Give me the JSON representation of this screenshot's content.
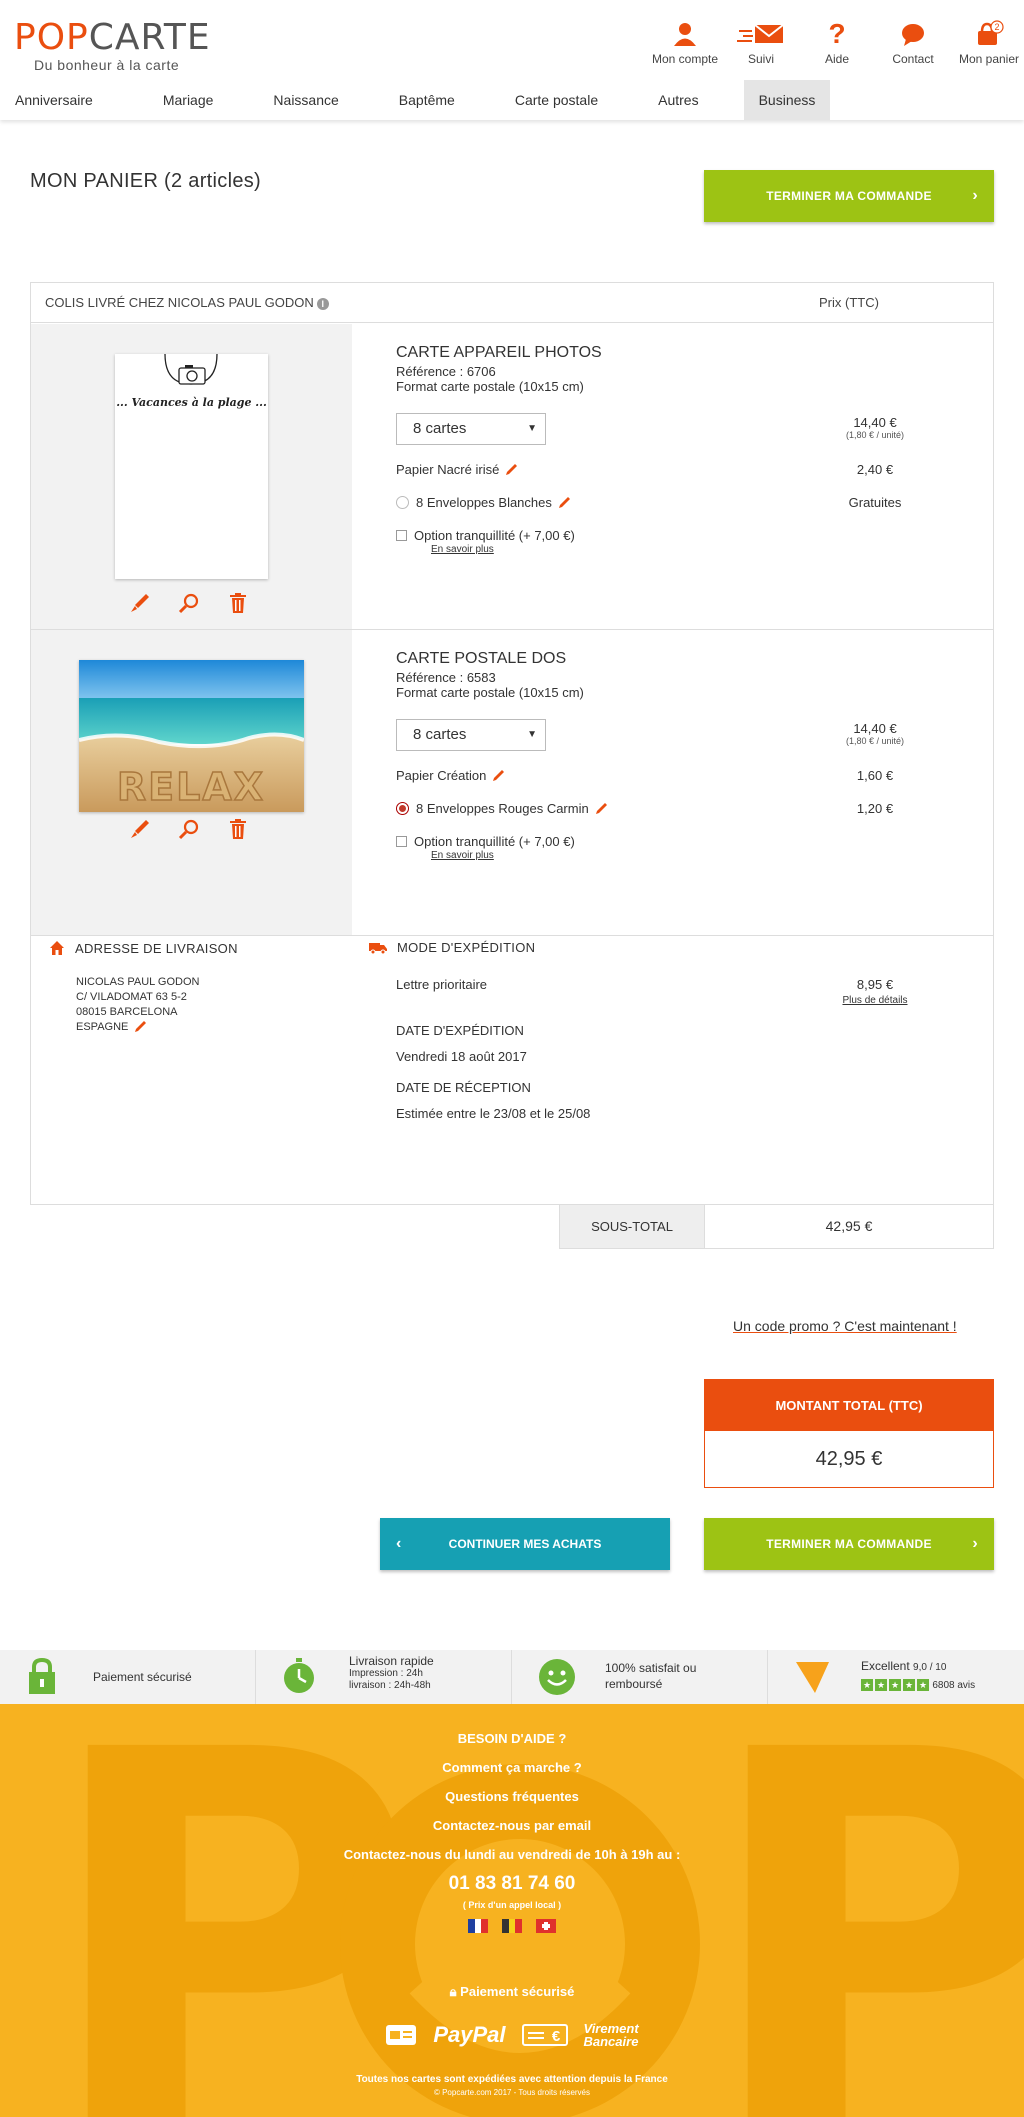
{
  "header": {
    "logo_pop": "POP",
    "logo_carte": "CARTE",
    "tagline": "Du bonheur à la carte",
    "cart_count": "2",
    "icons": [
      {
        "label": "Mon compte",
        "icon": "user-icon"
      },
      {
        "label": "Suivi",
        "icon": "envelope-icon"
      },
      {
        "label": "Aide",
        "icon": "help-icon"
      },
      {
        "label": "Contact",
        "icon": "chat-icon"
      },
      {
        "label": "Mon panier",
        "icon": "basket-icon"
      }
    ]
  },
  "nav": [
    "Anniversaire",
    "Mariage",
    "Naissance",
    "Baptême",
    "Carte postale",
    "Autres",
    "Business"
  ],
  "page_title": "MON PANIER (2 articles)",
  "buttons": {
    "finish": "TERMINER MA COMMANDE",
    "continue": "CONTINUER MES ACHATS"
  },
  "cart": {
    "colis": "COLIS LIVRÉ CHEZ NICOLAS PAUL GODON",
    "price_header": "Prix (TTC)",
    "products": [
      {
        "name": "CARTE APPAREIL PHOTOS",
        "reference": "Référence : 6706",
        "format": "Format carte postale (10x15 cm)",
        "quantity": "8 cartes",
        "price": "14,40 €",
        "unit": "(1,80 € / unité)",
        "card_text": "... Vacances à la plage ...",
        "paper": "Papier Nacré irisé",
        "paper_price": "2,40 €",
        "envelopes": "8 Enveloppes Blanches",
        "envelopes_price": "Gratuites",
        "option": "Option tranquillité (+ 7,00 €)",
        "more": "En savoir plus"
      },
      {
        "name": "CARTE POSTALE DOS",
        "reference": "Référence : 6583",
        "format": "Format carte postale (10x15 cm)",
        "quantity": "8 cartes",
        "price": "14,40 €",
        "unit": "(1,80 € / unité)",
        "card_text": "RELAX",
        "paper": "Papier Création",
        "paper_price": "1,60 €",
        "envelopes": "8 Enveloppes Rouges Carmin",
        "envelopes_price": "1,20 €",
        "option": "Option tranquillité (+ 7,00 €)",
        "more": "En savoir plus"
      }
    ],
    "address_title": "ADRESSE DE LIVRAISON",
    "address_lines": [
      "NICOLAS PAUL GODON",
      "C/ VILADOMAT 63 5-2",
      "08015 BARCELONA",
      "ESPAGNE"
    ],
    "shipping_title": "MODE D'EXPÉDITION",
    "shipping_mode": "Lettre prioritaire",
    "shipping_price": "8,95 €",
    "shipping_details": "Plus de détails",
    "ship_date_title": "DATE D'EXPÉDITION",
    "ship_date": "Vendredi 18 août 2017",
    "rec_date_title": "DATE DE RÉCEPTION",
    "rec_date": "Estimée entre le 23/08 et le 25/08"
  },
  "subtotal": {
    "label": "SOUS-TOTAL",
    "value": "42,95 €"
  },
  "promo": "Un code promo ? C'est maintenant !",
  "total": {
    "label": "MONTANT TOTAL (TTC)",
    "value": "42,95 €"
  },
  "reassurance": {
    "payment": "Paiement sécurisé",
    "delivery": "Livraison rapide",
    "delivery_print": "Impression : 24h",
    "delivery_ship": "livraison : 24h-48h",
    "satisfied_1": "100% satisfait ou",
    "satisfied_2": "remboursé",
    "rating": "Excellent",
    "rating_score": "9,0 / 10",
    "rating_count": "6808 avis"
  },
  "footer": {
    "help": "BESOIN D'AIDE ?",
    "how": "Comment ça marche ?",
    "faq": "Questions fréquentes",
    "email": "Contactez-nous par email",
    "hours": "Contactez-nous du lundi au vendredi de 10h à 19h au :",
    "phone": "01 83 81 74 60",
    "phone_note": "( Prix d'un appel local )",
    "secure": "Paiement sécurisé",
    "paypal": "PayPal",
    "virement": "Virement",
    "bancaire": "Bancaire",
    "note": "Toutes nos cartes sont expédiées avec attention depuis la France",
    "copyright": "© Popcarte.com 2017 - Tous droits réservés"
  },
  "colors": {
    "orange": "#ea4e0f",
    "green": "#9dc314",
    "teal": "#16a0b3",
    "footer": "#f7b220"
  }
}
